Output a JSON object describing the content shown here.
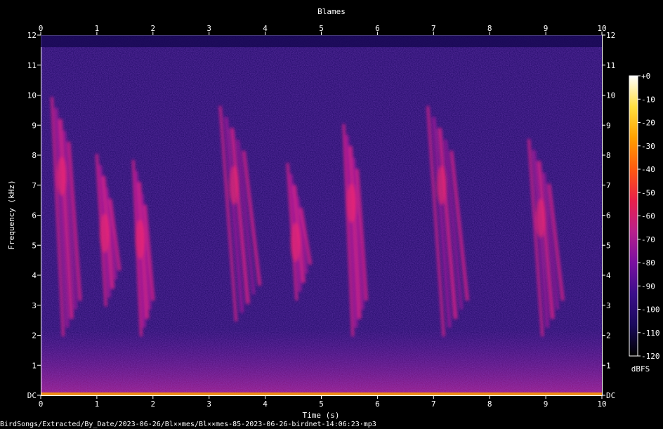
{
  "chart_data": {
    "type": "heatmap",
    "title": "Blames",
    "xlabel": "Time (s)",
    "ylabel": "Frequency (kHz)",
    "xlim": [
      0,
      10
    ],
    "ylim": [
      0,
      12
    ],
    "x_ticks": [
      "0",
      "1",
      "2",
      "3",
      "4",
      "5",
      "6",
      "7",
      "8",
      "9",
      "10"
    ],
    "y_ticks": [
      "DC",
      "1",
      "2",
      "3",
      "4",
      "5",
      "6",
      "7",
      "8",
      "9",
      "10",
      "11",
      "12"
    ],
    "colorbar": {
      "unit": "dBFS",
      "ticks": [
        "+0",
        "-10",
        "-20",
        "-30",
        "-40",
        "-50",
        "-60",
        "-70",
        "-80",
        "-90",
        "-100",
        "-110",
        "-120"
      ],
      "range": [
        -120,
        0
      ],
      "colors": [
        "#000000",
        "#1a0a5c",
        "#3b0e8a",
        "#7a10a0",
        "#b8208c",
        "#e8204a",
        "#ff5a10",
        "#ffa000",
        "#ffe040",
        "#ffffff"
      ]
    },
    "background_color": "#2a1070",
    "calls": [
      {
        "t_start": 0.2,
        "t_end": 0.7,
        "f_high": 9.9,
        "f_low": 2.0
      },
      {
        "t_start": 1.0,
        "t_end": 1.4,
        "f_high": 8.0,
        "f_low": 3.0
      },
      {
        "t_start": 1.65,
        "t_end": 2.0,
        "f_high": 7.8,
        "f_low": 2.0
      },
      {
        "t_start": 3.2,
        "t_end": 3.9,
        "f_high": 9.6,
        "f_low": 2.5
      },
      {
        "t_start": 4.4,
        "t_end": 4.8,
        "f_high": 7.7,
        "f_low": 3.2
      },
      {
        "t_start": 5.4,
        "t_end": 5.8,
        "f_high": 9.0,
        "f_low": 2.0
      },
      {
        "t_start": 6.9,
        "t_end": 7.6,
        "f_high": 9.6,
        "f_low": 2.0
      },
      {
        "t_start": 8.7,
        "t_end": 9.3,
        "f_high": 8.5,
        "f_low": 2.0
      }
    ]
  },
  "footer": {
    "path": "BirdSongs/Extracted/By_Date/2023-06-26/Bl××mes/Bl××mes-85-2023-06-26-birdnet-14:06:23·mp3"
  }
}
